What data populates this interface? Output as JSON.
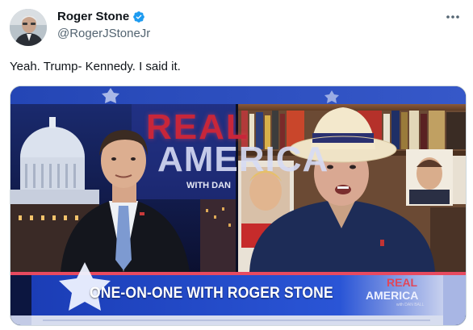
{
  "author": {
    "display_name": "Roger Stone",
    "handle": "@RogerJStoneJr",
    "verified_icon": "verified-badge-icon",
    "avatar_icon": "profile-avatar"
  },
  "post": {
    "text": "Yeah. Trump- Kennedy. I said it."
  },
  "menu": {
    "icon": "more-options-icon"
  },
  "media": {
    "banner_text": "ONE-ON-ONE WITH ROGER STONE",
    "logo_real": "REAL",
    "logo_america": "AMERICA",
    "logo_with": "WITH DAN",
    "corner_real": "REAL",
    "corner_america": "AMERICA",
    "corner_with": "with DAN BALL"
  },
  "colors": {
    "text_primary": "#0f1419",
    "text_secondary": "#536471",
    "verified_blue": "#1d9bf0",
    "banner_blue": "#1f47c8",
    "logo_red": "#c8263a"
  }
}
